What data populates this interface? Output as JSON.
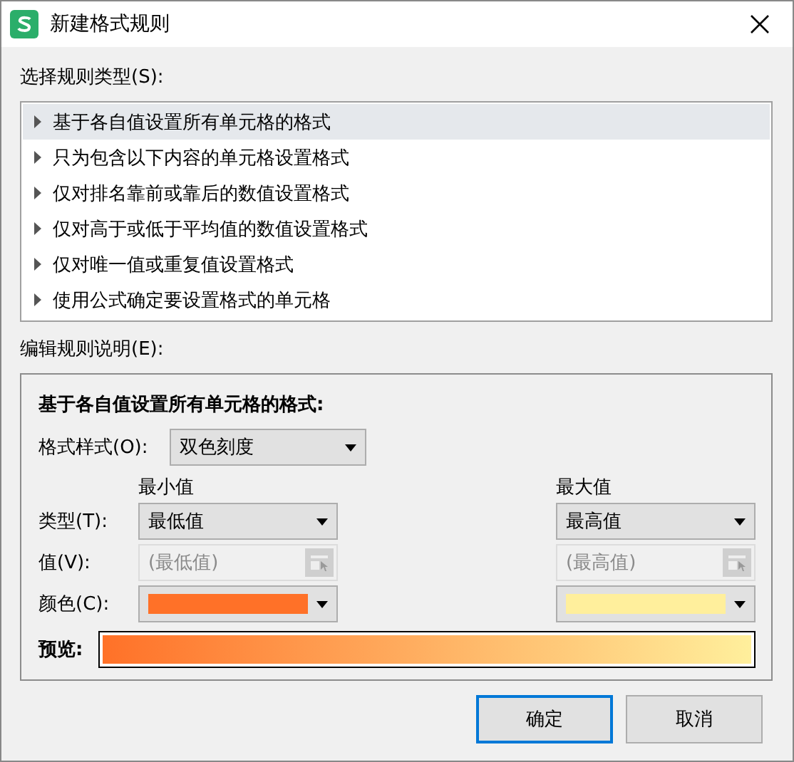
{
  "window": {
    "title": "新建格式规则"
  },
  "rule_type_label": "选择规则类型(S):",
  "rules": [
    {
      "label": "基于各自值设置所有单元格的格式",
      "selected": true
    },
    {
      "label": "只为包含以下内容的单元格设置格式",
      "selected": false
    },
    {
      "label": "仅对排名靠前或靠后的数值设置格式",
      "selected": false
    },
    {
      "label": "仅对高于或低于平均值的数值设置格式",
      "selected": false
    },
    {
      "label": "仅对唯一值或重复值设置格式",
      "selected": false
    },
    {
      "label": "使用公式确定要设置格式的单元格",
      "selected": false
    }
  ],
  "description_label": "编辑规则说明(E):",
  "description": {
    "heading": "基于各自值设置所有单元格的格式:",
    "format_style": {
      "label": "格式样式(O):",
      "value": "双色刻度"
    },
    "row_labels": {
      "type_label": "类型(T):",
      "value_label": "值(V):",
      "color_label": "颜色(C):"
    },
    "min": {
      "header": "最小值",
      "type": "最低值",
      "placeholder": "(最低值)",
      "disabled": true,
      "color": "#ff7128"
    },
    "max": {
      "header": "最大值",
      "type": "最高值",
      "placeholder": "(最高值)",
      "disabled": true,
      "color": "#ffef9c"
    },
    "preview_label": "预览:"
  },
  "buttons": [
    {
      "label": "确定",
      "default": true
    },
    {
      "label": "取消",
      "default": false
    }
  ]
}
